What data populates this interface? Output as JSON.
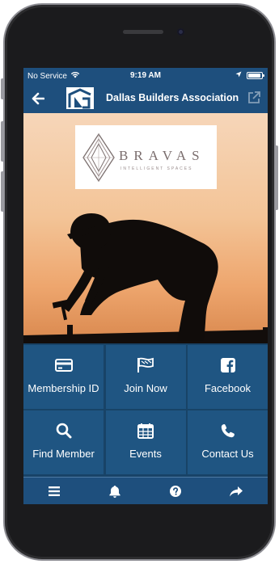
{
  "status_bar": {
    "carrier": "No Service",
    "time": "9:19 AM"
  },
  "nav_bar": {
    "back_icon": "arrow-left-icon",
    "title": "Dallas Builders Association",
    "share_icon": "external-link-icon"
  },
  "hero": {
    "sponsor_name": "BRAVAS",
    "sponsor_tagline": "INTELLIGENT SPACES"
  },
  "tiles": [
    {
      "label": "Membership ID",
      "icon": "id-card-icon"
    },
    {
      "label": "Join Now",
      "icon": "flag-icon"
    },
    {
      "label": "Facebook",
      "icon": "facebook-icon"
    },
    {
      "label": "Find Member",
      "icon": "search-icon"
    },
    {
      "label": "Events",
      "icon": "calendar-icon"
    },
    {
      "label": "Contact Us",
      "icon": "phone-icon"
    }
  ],
  "tab_bar": {
    "items": [
      "menu-icon",
      "bell-icon",
      "help-icon",
      "share-icon"
    ]
  },
  "colors": {
    "primary": "#1e4f7d",
    "tile": "#1f5582",
    "tile_gap": "#184367"
  }
}
